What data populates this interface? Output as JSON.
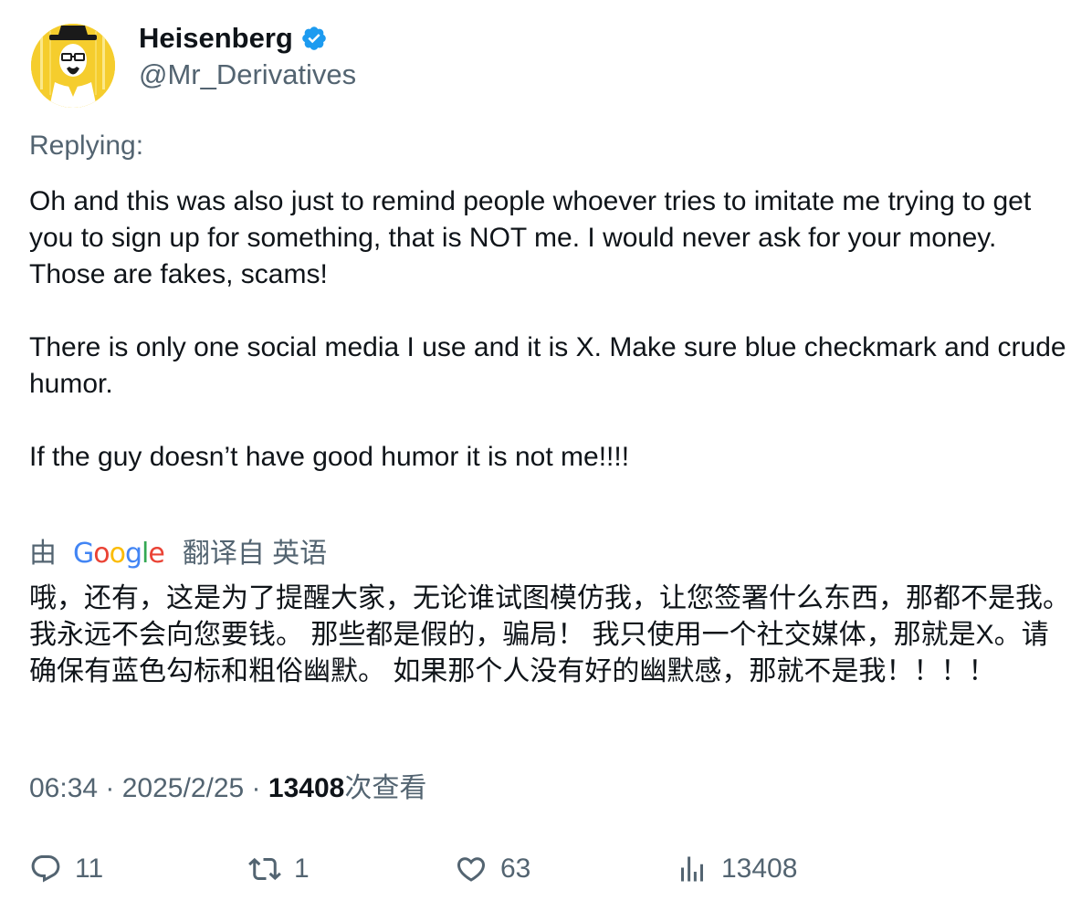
{
  "author": {
    "display_name": "Heisenberg",
    "handle": "@Mr_Derivatives",
    "verified": true,
    "verified_color": "#1d9bf0"
  },
  "replying_label": "Replying:",
  "tweet": {
    "text": "Oh and this was also just to remind people whoever tries to imitate me trying to get you to sign up for something, that is NOT me. I would never ask for your money.\nThose are fakes, scams!\n\nThere is only one social media I use and it is X. Make sure blue checkmark and crude humor.\n\nIf the guy doesn’t have good humor it is not me!!!!"
  },
  "translation": {
    "prefix": "由",
    "provider": "Google",
    "suffix": "翻译自 英语",
    "text": "哦，还有，这是为了提醒大家，无论谁试图模仿我，让您签署什么东西，那都不是我。我永远不会向您要钱。 那些都是假的，骗局！ 我只使用一个社交媒体，那就是X。请确保有蓝色勾标和粗俗幽默。 如果那个人没有好的幽默感，那就不是我！！！！"
  },
  "meta": {
    "time": "06:34",
    "separator": " · ",
    "date": "2025/2/25",
    "views_count": "13408",
    "views_label": "次查看"
  },
  "actions": {
    "reply_count": "11",
    "retweet_count": "1",
    "like_count": "63",
    "views_count": "13408"
  },
  "colors": {
    "text_primary": "#0f1419",
    "text_secondary": "#536471",
    "avatar_bg": "#f7d235"
  },
  "icons": {
    "verified": "verified-badge-icon",
    "reply": "reply-icon",
    "retweet": "retweet-icon",
    "like": "heart-icon",
    "views": "analytics-icon"
  }
}
